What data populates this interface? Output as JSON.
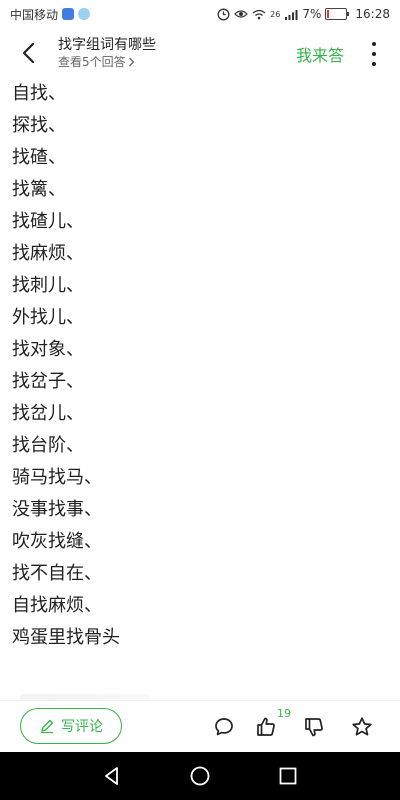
{
  "status_bar": {
    "carrier": "中国移动",
    "network": "26",
    "battery": "7%",
    "battery_level": 0.07,
    "time": "16:28"
  },
  "header": {
    "title": "找字组词有哪些",
    "subtitle": "查看5个回答",
    "answer_button": "我来答"
  },
  "words": [
    "自找、",
    "探找、",
    "找碴、",
    "找篱、",
    "找碴儿、",
    "找麻烦、",
    "找刺儿、",
    "外找儿、",
    "找对象、",
    "找岔子、",
    "找岔儿、",
    "找台阶、",
    "骑马找马、",
    "没事找事、",
    "吹灰找缝、",
    "找不自在、",
    "自找麻烦、",
    "鸡蛋里找骨头"
  ],
  "action_bar": {
    "comment_button": "写评论",
    "like_count": "19"
  },
  "colors": {
    "accent": "#37b34a",
    "text": "#222222",
    "navbar": "#000000"
  },
  "icons": {
    "back": "back-arrow-icon",
    "more": "more-vertical-icon",
    "comment": "comment-bubble-icon",
    "like": "thumbs-up-icon",
    "dislike": "thumbs-down-icon",
    "favorite": "star-icon",
    "pen": "pen-icon"
  }
}
